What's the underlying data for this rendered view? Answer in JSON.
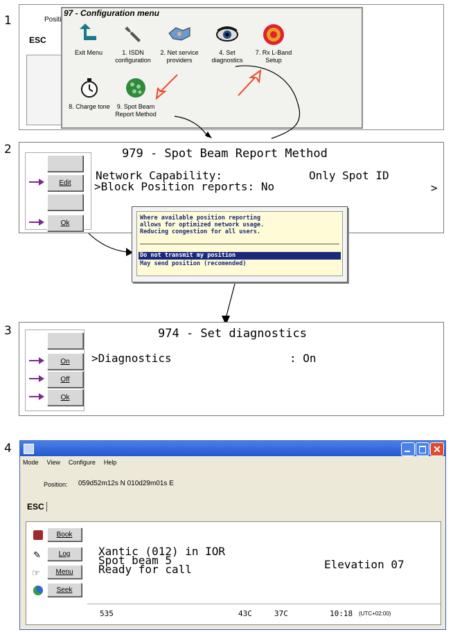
{
  "steps": [
    "1",
    "2",
    "3",
    "4"
  ],
  "panel1": {
    "title": "97 - Configuration menu",
    "posi": "Positi",
    "esc": "ESC",
    "items": [
      {
        "label1": "Exit Menu",
        "label2": "",
        "icon": "exit-arrow-icon"
      },
      {
        "label1": "1. ISDN",
        "label2": "configuration",
        "icon": "wrench-icon"
      },
      {
        "label1": "2. Net service",
        "label2": "providers",
        "icon": "handshake-icon"
      },
      {
        "label1": "4. Set",
        "label2": "diagnostics",
        "icon": "eye-icon"
      },
      {
        "label1": "7. Rx L-Band",
        "label2": "Setup",
        "icon": "target-icon"
      },
      {
        "label1": "8. Charge tone",
        "label2": "",
        "icon": "stopwatch-icon"
      },
      {
        "label1": "9. Spot Beam",
        "label2": "Report Method",
        "icon": "globe-icon"
      }
    ]
  },
  "panel2": {
    "title": "979 - Spot Beam Report Method",
    "row1_label": "Network Capability:",
    "row1_value": "Only Spot ID",
    "row2_label": ">Block Position reports: No",
    "right_marker": ">",
    "btn_edit": "Edit",
    "btn_ok": "Ok",
    "popup": {
      "text": [
        "Where available position reporting",
        "allows for optimized network usage.",
        "Reducing congestion for all users."
      ],
      "options": [
        "Do not transmit my position",
        "May send position (recomended)"
      ]
    }
  },
  "panel3": {
    "title": "974 - Set diagnostics",
    "row_label": ">Diagnostics",
    "row_value": ": On",
    "btn_on": "On",
    "btn_off": "Off",
    "btn_ok": "Ok"
  },
  "panel4": {
    "menu": [
      "Mode",
      "View",
      "Configure",
      "Help"
    ],
    "position_label": "Position:",
    "position_value": "059d52m12s N 010d29m01s E",
    "esc": "ESC",
    "buttons": [
      "Book",
      "Log",
      "Menu",
      "Seek"
    ],
    "line1": "Xantic (012) in IOR",
    "line2": "Spot beam 5",
    "line3": "Ready for call",
    "elevation": "Elevation 07",
    "status": {
      "code": "535",
      "t1": "43C",
      "t2": "37C",
      "time": "10:18",
      "tz": "(UTC+02:00)"
    }
  },
  "colors": {
    "arrow": "#7a2a8a",
    "title_bar": "#2b63d9",
    "popup_bg": "#fffbd6",
    "popup_sel": "#1a2a7a",
    "hint": "#e84a2a"
  }
}
